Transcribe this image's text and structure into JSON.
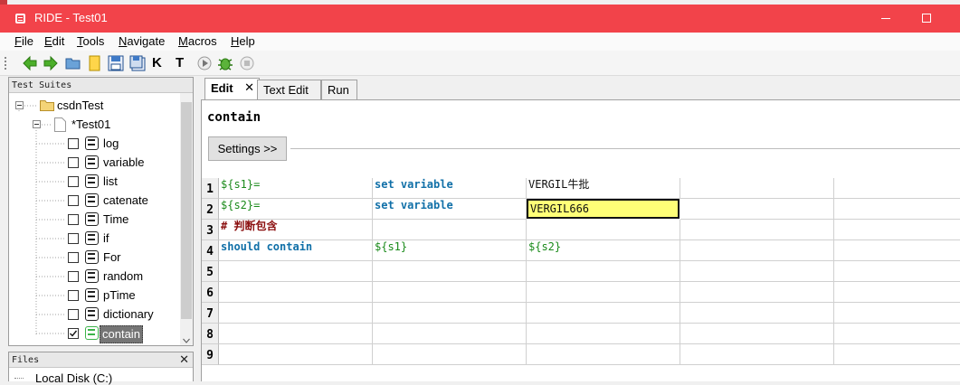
{
  "window": {
    "title": "RIDE - Test01"
  },
  "menu": [
    {
      "label": "File",
      "ul": "F",
      "rest": "ile"
    },
    {
      "label": "Edit",
      "ul": "E",
      "rest": "dit"
    },
    {
      "label": "Tools",
      "ul": "T",
      "rest": "ools"
    },
    {
      "label": "Navigate",
      "ul": "N",
      "rest": "avigate"
    },
    {
      "label": "Macros",
      "ul": "M",
      "rest": "acros"
    },
    {
      "label": "Help",
      "ul": "H",
      "rest": "elp"
    }
  ],
  "toolbar": {
    "icons": [
      "back-arrow-icon",
      "forward-arrow-icon",
      "open-folder-icon",
      "new-file-icon",
      "save-icon",
      "save-all-icon",
      "search-keywords-icon",
      "search-tests-icon",
      "run-icon",
      "debug-icon",
      "stop-icon"
    ],
    "k_label": "K",
    "t_label": "T"
  },
  "tree": {
    "header": "Test Suites",
    "suite": "csdnTest",
    "testfile": "*Test01",
    "items": [
      {
        "label": "log",
        "checked": false
      },
      {
        "label": "variable",
        "checked": false
      },
      {
        "label": "list",
        "checked": false
      },
      {
        "label": "catenate",
        "checked": false
      },
      {
        "label": "Time",
        "checked": false
      },
      {
        "label": "if",
        "checked": false
      },
      {
        "label": "For",
        "checked": false
      },
      {
        "label": "random",
        "checked": false
      },
      {
        "label": "pTime",
        "checked": false
      },
      {
        "label": "dictionary",
        "checked": false
      },
      {
        "label": "contain",
        "checked": true,
        "selected": true
      }
    ]
  },
  "files": {
    "header": "Files",
    "first_item": "Local Disk (C:)"
  },
  "tabs": [
    {
      "label": "Edit",
      "active": true
    },
    {
      "label": "Text Edit",
      "active": false
    },
    {
      "label": "Run",
      "active": false
    }
  ],
  "editor": {
    "keyword_name": "contain",
    "settings_label": "Settings >>",
    "rows": [
      {
        "num": "1",
        "cells": [
          {
            "text": "${s1}=",
            "kind": "var"
          },
          {
            "text": "set variable",
            "kind": "kw"
          },
          {
            "text": "VERGIL牛批",
            "kind": "txt"
          },
          {
            "text": "",
            "kind": "txt"
          },
          {
            "text": "",
            "kind": "txt"
          }
        ]
      },
      {
        "num": "2",
        "cells": [
          {
            "text": "${s2}=",
            "kind": "var"
          },
          {
            "text": "set variable",
            "kind": "kw"
          },
          {
            "text": "VERGIL666",
            "kind": "txt",
            "selected": true
          },
          {
            "text": "",
            "kind": "txt"
          },
          {
            "text": "",
            "kind": "txt"
          }
        ]
      },
      {
        "num": "3",
        "cells": [
          {
            "text": "# 判断包含",
            "kind": "comment"
          },
          {
            "text": "",
            "kind": "txt"
          },
          {
            "text": "",
            "kind": "txt"
          },
          {
            "text": "",
            "kind": "txt"
          },
          {
            "text": "",
            "kind": "txt"
          }
        ]
      },
      {
        "num": "4",
        "cells": [
          {
            "text": "should contain",
            "kind": "kw"
          },
          {
            "text": "${s1}",
            "kind": "var"
          },
          {
            "text": "${s2}",
            "kind": "var"
          },
          {
            "text": "",
            "kind": "txt"
          },
          {
            "text": "",
            "kind": "txt"
          }
        ]
      },
      {
        "num": "5",
        "cells": [
          {
            "text": "",
            "kind": "txt"
          },
          {
            "text": "",
            "kind": "txt"
          },
          {
            "text": "",
            "kind": "txt"
          },
          {
            "text": "",
            "kind": "txt"
          },
          {
            "text": "",
            "kind": "txt"
          }
        ]
      },
      {
        "num": "6",
        "cells": [
          {
            "text": "",
            "kind": "txt"
          },
          {
            "text": "",
            "kind": "txt"
          },
          {
            "text": "",
            "kind": "txt"
          },
          {
            "text": "",
            "kind": "txt"
          },
          {
            "text": "",
            "kind": "txt"
          }
        ]
      },
      {
        "num": "7",
        "cells": [
          {
            "text": "",
            "kind": "txt"
          },
          {
            "text": "",
            "kind": "txt"
          },
          {
            "text": "",
            "kind": "txt"
          },
          {
            "text": "",
            "kind": "txt"
          },
          {
            "text": "",
            "kind": "txt"
          }
        ]
      },
      {
        "num": "8",
        "cells": [
          {
            "text": "",
            "kind": "txt"
          },
          {
            "text": "",
            "kind": "txt"
          },
          {
            "text": "",
            "kind": "txt"
          },
          {
            "text": "",
            "kind": "txt"
          },
          {
            "text": "",
            "kind": "txt"
          }
        ]
      },
      {
        "num": "9",
        "cells": [
          {
            "text": "",
            "kind": "txt"
          },
          {
            "text": "",
            "kind": "txt"
          },
          {
            "text": "",
            "kind": "txt"
          },
          {
            "text": "",
            "kind": "txt"
          },
          {
            "text": "",
            "kind": "txt"
          }
        ]
      }
    ]
  },
  "colors": {
    "titlebar": "#f2434a",
    "variable": "#1a8a1a",
    "keyword": "#1170a8",
    "comment": "#8b0f0f",
    "selected_cell": "#ffff77"
  }
}
